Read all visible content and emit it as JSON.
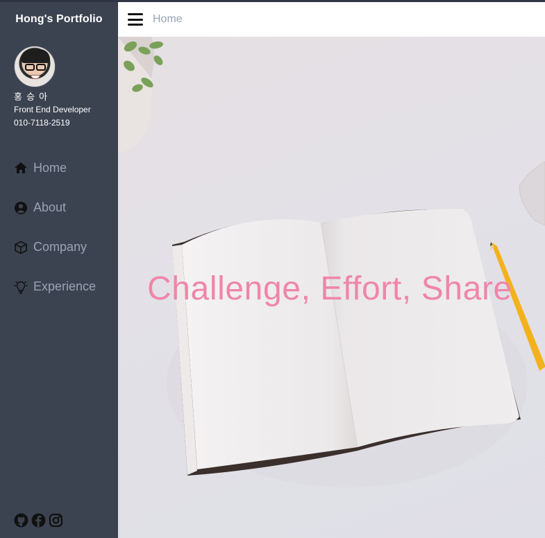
{
  "sidebar": {
    "brand": "Hong's Portfolio",
    "profile": {
      "name": "홍 승 아",
      "role": "Front End Developer",
      "phone": "010-7118-2519"
    },
    "items": [
      {
        "label": "Home",
        "icon": "home-icon"
      },
      {
        "label": "About",
        "icon": "user-circle-icon"
      },
      {
        "label": "Company",
        "icon": "cube-icon"
      },
      {
        "label": "Experience",
        "icon": "lightbulb-icon"
      }
    ],
    "social": [
      "github-icon",
      "facebook-icon",
      "instagram-icon"
    ]
  },
  "header": {
    "breadcrumb": "Home",
    "menu_icon": "hamburger-icon"
  },
  "hero": {
    "slogan": "Challenge, Effort, Share"
  },
  "colors": {
    "sidebar_bg": "#3c4350",
    "nav_text": "#9aa3b5",
    "slogan": "#ef86a9",
    "header_bg": "#ffffff"
  }
}
